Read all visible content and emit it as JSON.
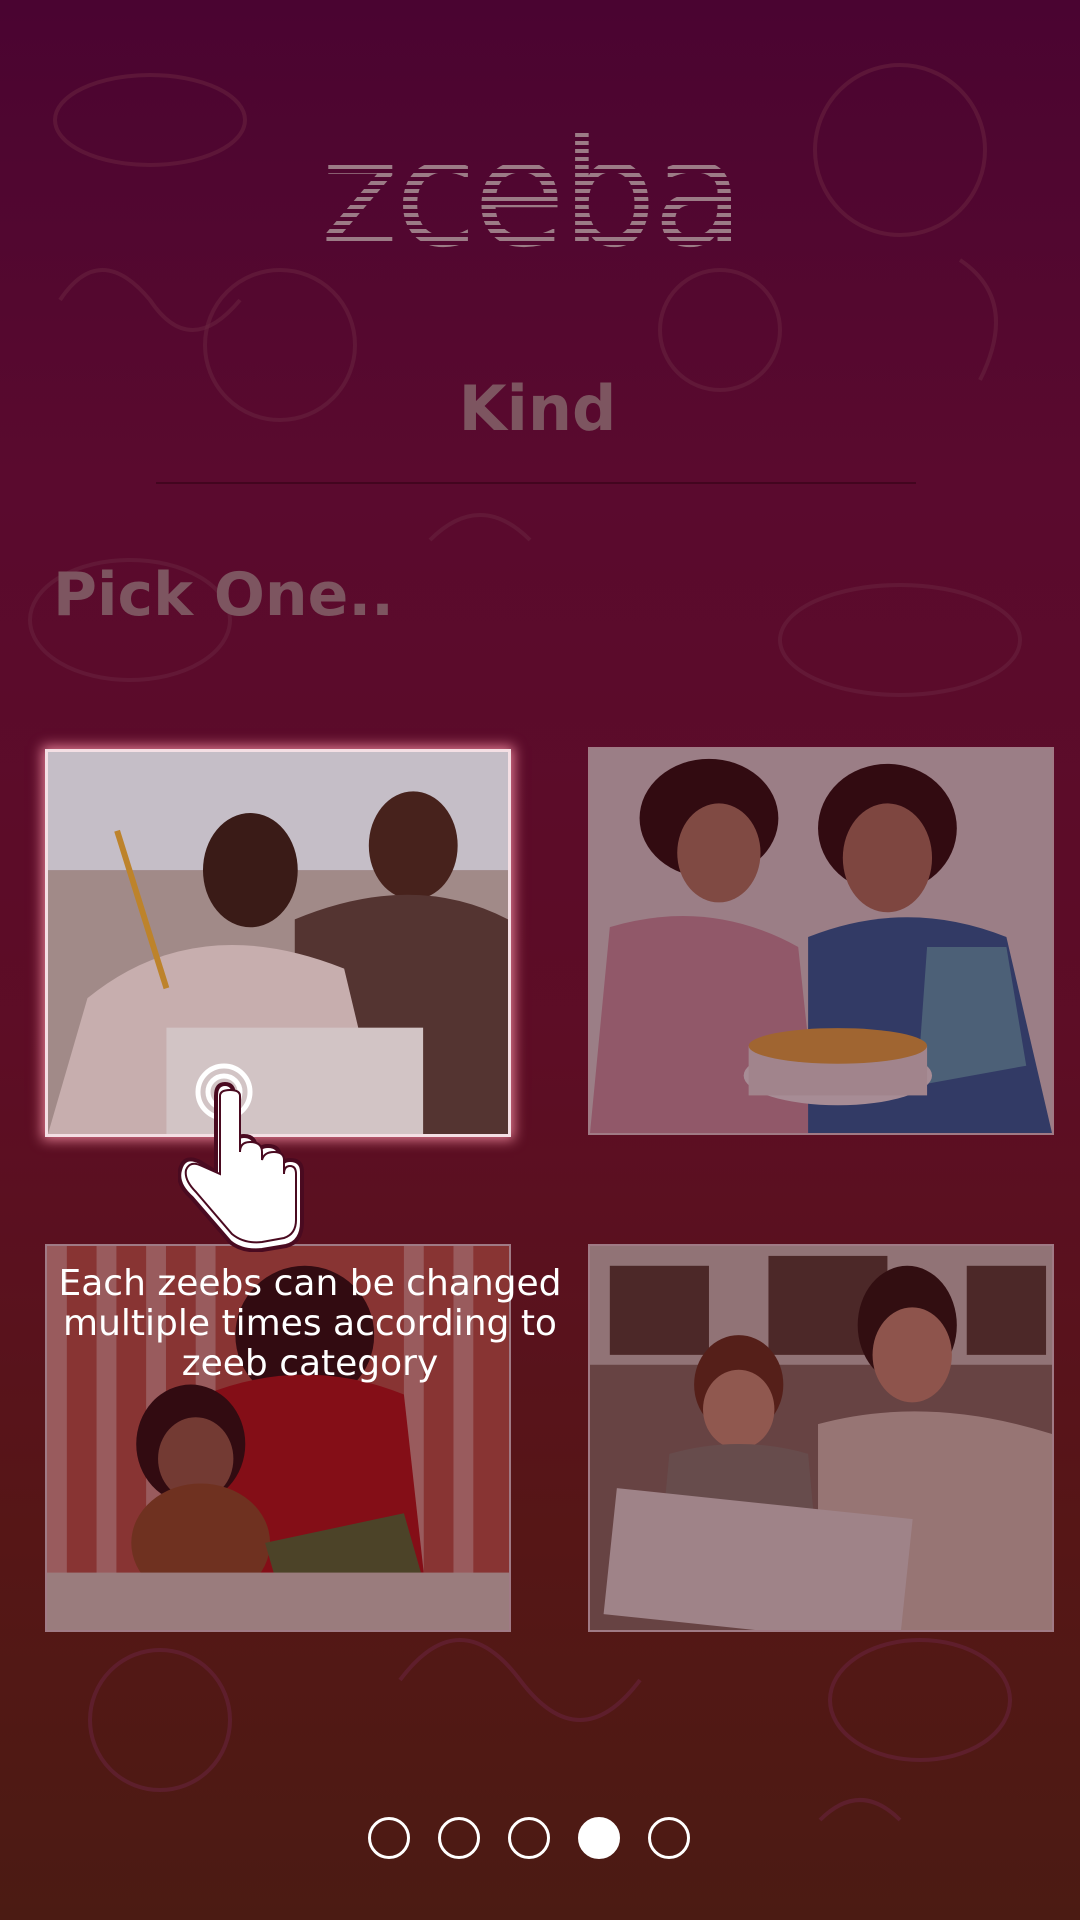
{
  "brand": {
    "logo_text": "zceba"
  },
  "header": {
    "title": "Kind"
  },
  "prompt": {
    "text": "Pick One.."
  },
  "tiles": [
    {
      "name": "father-son-homework",
      "selected": true
    },
    {
      "name": "mother-daughter-cake",
      "selected": false
    },
    {
      "name": "mother-daughter-reading",
      "selected": false
    },
    {
      "name": "father-son-study",
      "selected": false
    }
  ],
  "tutorial": {
    "tooltip": "Each zeebs can be changed multiple times according to zeeb category",
    "icon": "tap-hand-icon"
  },
  "pagination": {
    "total": 5,
    "active": 4
  },
  "colors": {
    "accent": "#ffffff",
    "background": "#5a0a2e",
    "muted_text": "#7d5560"
  }
}
